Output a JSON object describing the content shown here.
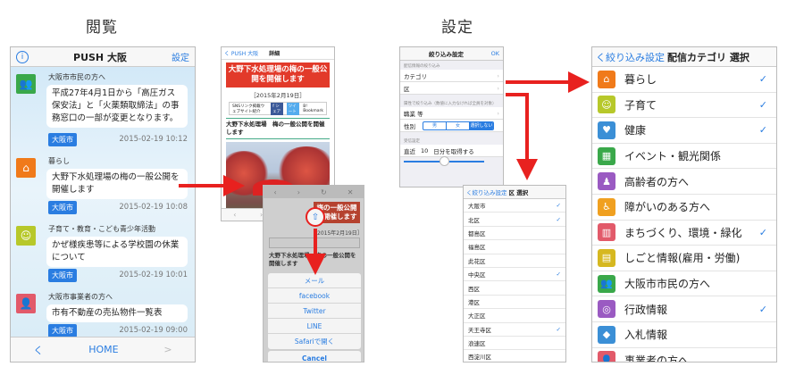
{
  "sections": {
    "view": "閲覧",
    "settings": "設定"
  },
  "colors": {
    "accent": "#2a7de1",
    "arrow": "#e8211f",
    "red_title": "#e23a2a",
    "date_tag": "#2a7de1"
  },
  "home_screen": {
    "info_icon": "info-icon",
    "title": "PUSH 大阪",
    "settings_label": "設定",
    "messages": [
      {
        "category": "大阪市市民の方へ",
        "icon": "citizens-icon",
        "icon_color": "#3aa84a",
        "text": "平成27年4月1日から「高圧ガス保安法」と「火薬類取締法」の事務窓口の一部が変更となります。",
        "tag": "大阪市",
        "time": "2015-02-19 10:12"
      },
      {
        "category": "暮らし",
        "icon": "house-icon",
        "icon_color": "#f07a1a",
        "text": "大野下水処理場の梅の一般公開を開催します",
        "tag": "大阪市",
        "time": "2015-02-19 10:08"
      },
      {
        "category": "子育て・教育・こども青少年活動",
        "icon": "child-icon",
        "icon_color": "#b7c82a",
        "text": "かぜ様疾患等による学校園の休業について",
        "tag": "大阪市",
        "time": "2015-02-19 10:01"
      },
      {
        "category": "大阪市事業者の方へ",
        "icon": "business-icon",
        "icon_color": "#e25a6a",
        "text": "市有不動産の売払物件一覧表",
        "tag": "大阪市",
        "time": "2015-02-19 09:00"
      }
    ],
    "bottom": {
      "back": "く",
      "home": "HOME",
      "forward": ">"
    }
  },
  "detail_screen": {
    "back": "く PUSH 大阪",
    "title": "詳細",
    "headline": "大野下水処理場の梅の一般公開を開催します",
    "date": "［2015年2月19日］",
    "share_text": "SNSリンク掲載ウェブサイト紹介",
    "facebook": "f シェア",
    "twitter": "ツイート",
    "bookmark": "B! Bookmark",
    "subheading": "大野下水処理場　梅の一般公開を開催します",
    "share_icon": "share-icon"
  },
  "share_sheet": {
    "headline_partial": "梅の一般公開を開催します",
    "date_partial": "2015年2月19日］",
    "subheading_partial": "大野下水処理場　梅の一般公開を開催します",
    "options": [
      "メール",
      "facebook",
      "Twitter",
      "LINE",
      "Safariで開く"
    ],
    "cancel": "Cancel"
  },
  "filter_screen": {
    "title": "絞り込み設定",
    "ok": "OK",
    "section1": "配信情報の絞り込み",
    "rows1": [
      "カテゴリ",
      "区"
    ],
    "section2": "属性で絞り込み（数値に入力なければ全員を対象）",
    "rows2": [
      "職業 等"
    ],
    "gender_label": "性別",
    "gender_options": [
      "男",
      "女",
      "選択しない"
    ],
    "section3": "受信設定",
    "time_label": "直近",
    "time_value": "10",
    "time_suffix": "日分を取得する"
  },
  "ward_screen": {
    "back": "く絞り込み設定",
    "title": "区 選択",
    "wards": [
      {
        "name": "大阪市",
        "checked": true
      },
      {
        "name": "北区",
        "checked": true
      },
      {
        "name": "都島区",
        "checked": false
      },
      {
        "name": "福島区",
        "checked": false
      },
      {
        "name": "此花区",
        "checked": false
      },
      {
        "name": "中央区",
        "checked": true
      },
      {
        "name": "西区",
        "checked": false
      },
      {
        "name": "港区",
        "checked": false
      },
      {
        "name": "大正区",
        "checked": false
      },
      {
        "name": "天王寺区",
        "checked": true
      },
      {
        "name": "浪速区",
        "checked": false
      },
      {
        "name": "西淀川区",
        "checked": false
      }
    ]
  },
  "category_screen": {
    "back": "く絞り込み設定",
    "title": "配信カテゴリ 選択",
    "categories": [
      {
        "label": "暮らし",
        "icon": "house-icon",
        "color": "#f07a1a",
        "checked": true
      },
      {
        "label": "子育て",
        "icon": "child-icon",
        "color": "#b7c82a",
        "checked": true
      },
      {
        "label": "健康",
        "icon": "heart-icon",
        "color": "#3b8fd6",
        "checked": true
      },
      {
        "label": "イベント・観光関係",
        "icon": "event-icon",
        "color": "#3aa84a",
        "checked": false
      },
      {
        "label": "高齢者の方へ",
        "icon": "elderly-icon",
        "color": "#9a5ac2",
        "checked": false
      },
      {
        "label": "障がいのある方へ",
        "icon": "wheelchair-icon",
        "color": "#f0a020",
        "checked": false
      },
      {
        "label": "まちづくり、環境・緑化",
        "icon": "building-icon",
        "color": "#e25a6a",
        "checked": true
      },
      {
        "label": "しごと情報(雇用・労働)",
        "icon": "work-icon",
        "color": "#d6b820",
        "checked": false
      },
      {
        "label": "大阪市市民の方へ",
        "icon": "citizens-icon",
        "color": "#3aa84a",
        "checked": false
      },
      {
        "label": "行政情報",
        "icon": "government-icon",
        "color": "#9a5ac2",
        "checked": true
      },
      {
        "label": "入札情報",
        "icon": "tender-icon",
        "color": "#3b8fd6",
        "checked": false
      },
      {
        "label": "事業者の方へ",
        "icon": "business-icon",
        "color": "#e25a6a",
        "checked": false
      }
    ]
  }
}
